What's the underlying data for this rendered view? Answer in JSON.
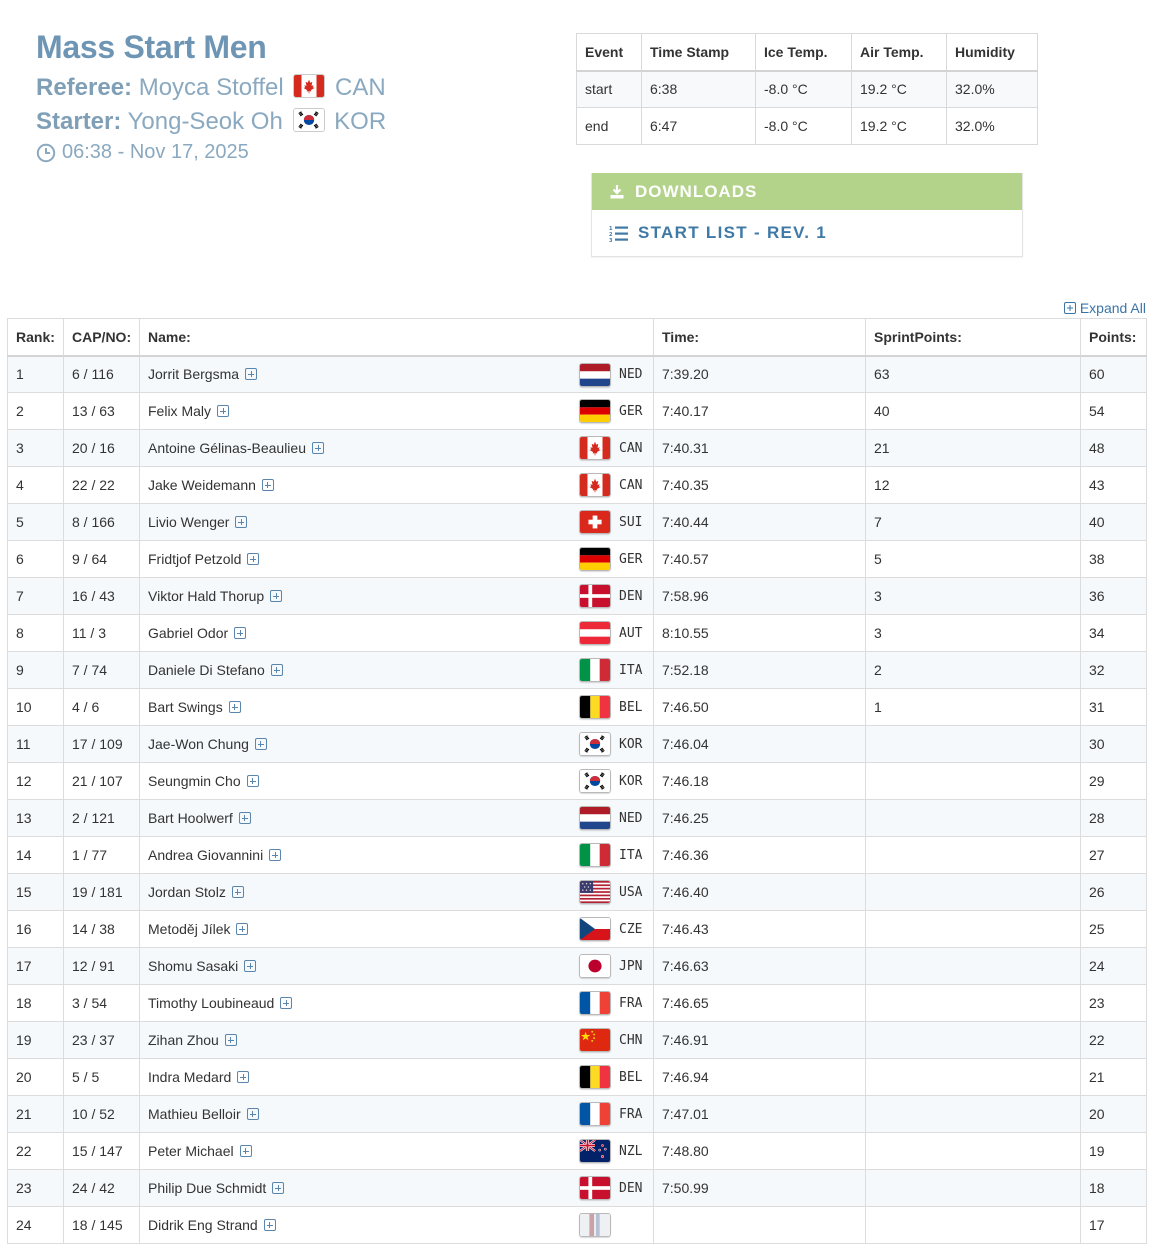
{
  "event": {
    "title": "Mass Start Men",
    "referee_label": "Referee:",
    "referee_name": "Moyca Stoffel",
    "referee_nation": "CAN",
    "starter_label": "Starter:",
    "starter_name": "Yong-Seok Oh",
    "starter_nation": "KOR",
    "datetime": "06:38 - Nov 17, 2025"
  },
  "conditions": {
    "headers": [
      "Event",
      "Time Stamp",
      "Ice Temp.",
      "Air Temp.",
      "Humidity"
    ],
    "rows": [
      [
        "start",
        "6:38",
        "-8.0 °C",
        "19.2 °C",
        "32.0%"
      ],
      [
        "end",
        "6:47",
        "-8.0 °C",
        "19.2 °C",
        "32.0%"
      ]
    ]
  },
  "downloads": {
    "title": "DOWNLOADS",
    "items": [
      "START LIST - REV. 1"
    ]
  },
  "expand_all": "Expand All",
  "results": {
    "headers": {
      "rank": "Rank:",
      "cap": "CAP/NO:",
      "name": "Name:",
      "time": "Time:",
      "sprint": "SprintPoints:",
      "points": "Points:"
    },
    "rows": [
      {
        "rank": "1",
        "cap": "6 / 116",
        "name": "Jorrit Bergsma",
        "nation": "NED",
        "time": "7:39.20",
        "sprint": "63",
        "points": "60"
      },
      {
        "rank": "2",
        "cap": "13 / 63",
        "name": "Felix Maly",
        "nation": "GER",
        "time": "7:40.17",
        "sprint": "40",
        "points": "54"
      },
      {
        "rank": "3",
        "cap": "20 / 16",
        "name": "Antoine Gélinas-Beaulieu",
        "nation": "CAN",
        "time": "7:40.31",
        "sprint": "21",
        "points": "48"
      },
      {
        "rank": "4",
        "cap": "22 / 22",
        "name": "Jake Weidemann",
        "nation": "CAN",
        "time": "7:40.35",
        "sprint": "12",
        "points": "43"
      },
      {
        "rank": "5",
        "cap": "8 / 166",
        "name": "Livio Wenger",
        "nation": "SUI",
        "time": "7:40.44",
        "sprint": "7",
        "points": "40"
      },
      {
        "rank": "6",
        "cap": "9 / 64",
        "name": "Fridtjof Petzold",
        "nation": "GER",
        "time": "7:40.57",
        "sprint": "5",
        "points": "38"
      },
      {
        "rank": "7",
        "cap": "16 / 43",
        "name": "Viktor Hald Thorup",
        "nation": "DEN",
        "time": "7:58.96",
        "sprint": "3",
        "points": "36"
      },
      {
        "rank": "8",
        "cap": "11 / 3",
        "name": "Gabriel Odor",
        "nation": "AUT",
        "time": "8:10.55",
        "sprint": "3",
        "points": "34"
      },
      {
        "rank": "9",
        "cap": "7 / 74",
        "name": "Daniele Di Stefano",
        "nation": "ITA",
        "time": "7:52.18",
        "sprint": "2",
        "points": "32"
      },
      {
        "rank": "10",
        "cap": "4 / 6",
        "name": "Bart Swings",
        "nation": "BEL",
        "time": "7:46.50",
        "sprint": "1",
        "points": "31"
      },
      {
        "rank": "11",
        "cap": "17 / 109",
        "name": "Jae-Won Chung",
        "nation": "KOR",
        "time": "7:46.04",
        "sprint": "",
        "points": "30"
      },
      {
        "rank": "12",
        "cap": "21 / 107",
        "name": "Seungmin Cho",
        "nation": "KOR",
        "time": "7:46.18",
        "sprint": "",
        "points": "29"
      },
      {
        "rank": "13",
        "cap": "2 / 121",
        "name": "Bart Hoolwerf",
        "nation": "NED",
        "time": "7:46.25",
        "sprint": "",
        "points": "28"
      },
      {
        "rank": "14",
        "cap": "1 / 77",
        "name": "Andrea Giovannini",
        "nation": "ITA",
        "time": "7:46.36",
        "sprint": "",
        "points": "27"
      },
      {
        "rank": "15",
        "cap": "19 / 181",
        "name": "Jordan Stolz",
        "nation": "USA",
        "time": "7:46.40",
        "sprint": "",
        "points": "26"
      },
      {
        "rank": "16",
        "cap": "14 / 38",
        "name": "Metoděj Jílek",
        "nation": "CZE",
        "time": "7:46.43",
        "sprint": "",
        "points": "25"
      },
      {
        "rank": "17",
        "cap": "12 / 91",
        "name": "Shomu Sasaki",
        "nation": "JPN",
        "time": "7:46.63",
        "sprint": "",
        "points": "24"
      },
      {
        "rank": "18",
        "cap": "3 / 54",
        "name": "Timothy Loubineaud",
        "nation": "FRA",
        "time": "7:46.65",
        "sprint": "",
        "points": "23"
      },
      {
        "rank": "19",
        "cap": "23 / 37",
        "name": "Zihan Zhou",
        "nation": "CHN",
        "time": "7:46.91",
        "sprint": "",
        "points": "22"
      },
      {
        "rank": "20",
        "cap": "5 / 5",
        "name": "Indra Medard",
        "nation": "BEL",
        "time": "7:46.94",
        "sprint": "",
        "points": "21"
      },
      {
        "rank": "21",
        "cap": "10 / 52",
        "name": "Mathieu Belloir",
        "nation": "FRA",
        "time": "7:47.01",
        "sprint": "",
        "points": "20"
      },
      {
        "rank": "22",
        "cap": "15 / 147",
        "name": "Peter Michael",
        "nation": "NZL",
        "time": "7:48.80",
        "sprint": "",
        "points": "19"
      },
      {
        "rank": "23",
        "cap": "24 / 42",
        "name": "Philip Due Schmidt",
        "nation": "DEN",
        "time": "7:50.99",
        "sprint": "",
        "points": "18"
      },
      {
        "rank": "24",
        "cap": "18 / 145",
        "name": "Didrik Eng Strand",
        "nation": "",
        "time": "",
        "sprint": "",
        "points": "17"
      }
    ]
  },
  "icons": {
    "clock": "clock-icon",
    "download": "download-icon",
    "list": "list-icon",
    "expand": "plus-square-icon",
    "flag": "flag-icon"
  },
  "colors": {
    "title": "#6e95b3",
    "downloads_header": "#b3d38b",
    "link": "#3f79a6",
    "row_stripe": "#f6f9fc"
  }
}
